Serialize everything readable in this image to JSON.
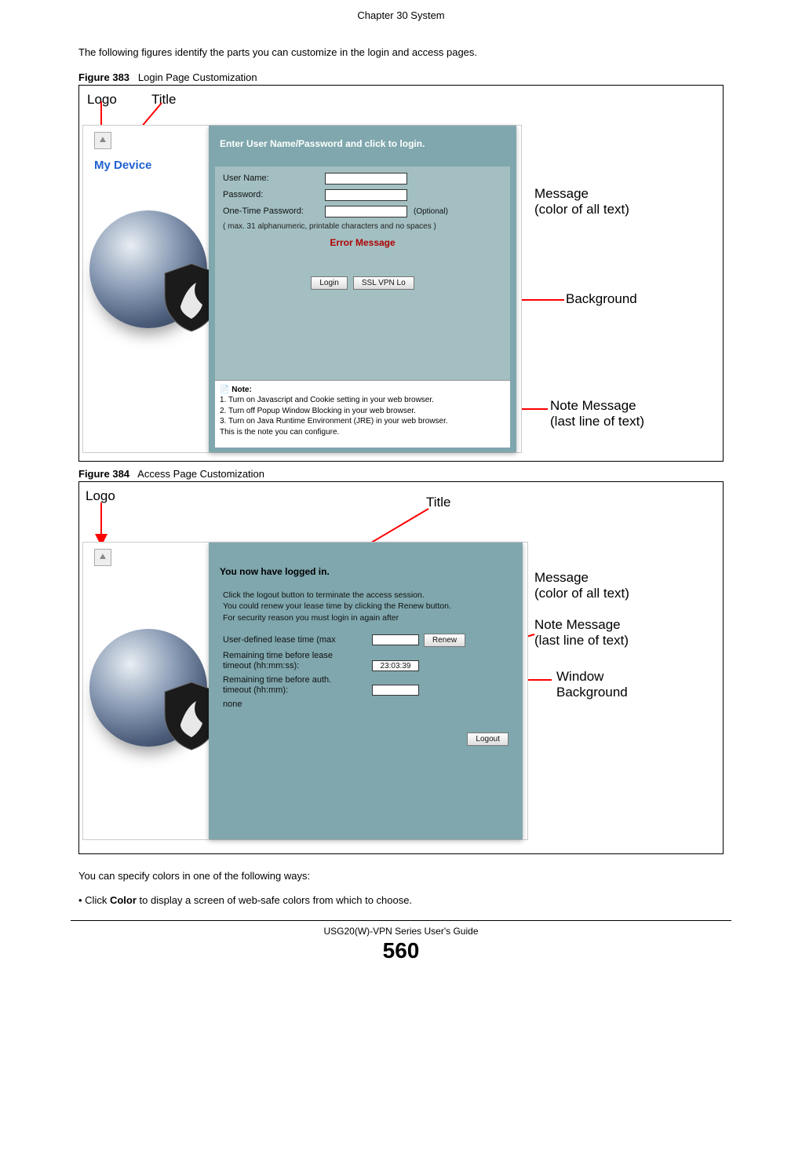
{
  "header": {
    "chapter": "Chapter 30 System"
  },
  "body": {
    "intro": "The following figures identify the parts you can customize in the login and access pages.",
    "fig383": {
      "num": "Figure 383",
      "caption": "Login Page Customization"
    },
    "fig384": {
      "num": "Figure 384",
      "caption": "Access Page Customization"
    },
    "colorways": "You can specify colors in one of the following ways:",
    "bullet": "Click Color to display a screen of web-safe colors from which to choose.",
    "bullet_prefix": "• Click ",
    "bullet_bold": "Color",
    "bullet_suffix": " to display a screen of web-safe colors from which to choose."
  },
  "annotations": {
    "logo": "Logo",
    "title": "Title",
    "message": "Message",
    "message_sub": " (color of all text)",
    "background": "Background",
    "note_message": "Note Message",
    "note_message_sub": "   (last line of text)",
    "window": "Window",
    "window_sub": "Background"
  },
  "login": {
    "device": "My Device",
    "heading": "Enter User Name/Password and click to login.",
    "user_label": "User Name:",
    "pass_label": "Password:",
    "otp_label": "One-Time Password:",
    "optional": "(Optional)",
    "limit": "( max. 31 alphanumeric, printable characters and no spaces )",
    "error": "Error Message",
    "login_btn": "Login",
    "ssl_btn": "SSL VPN Lo",
    "note_head": "Note:",
    "note1": "1. Turn on Javascript and Cookie setting in your web browser.",
    "note2": "2. Turn off Popup Window Blocking in your web browser.",
    "note3": "3. Turn on Java Runtime Environment (JRE) in your web browser.",
    "note4": "This is the note you can configure."
  },
  "access": {
    "heading": "You now have logged in.",
    "desc1": "Click the logout button to terminate the access session.",
    "desc2": "You could renew your lease time by clicking the Renew button.",
    "desc3": "For security reason you must login in again after",
    "lease_label": "User-defined lease time (max",
    "renew_btn": "Renew",
    "remain_lease": "Remaining time before lease",
    "timeout_hms": "timeout (hh:mm:ss):",
    "remain_auth": "Remaining time before auth.",
    "timeout_hms2": "timeout (hh:mm):",
    "remain_value": "23:03:39",
    "none": "none",
    "logout_btn": "Logout"
  },
  "footer": {
    "guide": "USG20(W)-VPN Series User's Guide",
    "page": "560"
  }
}
